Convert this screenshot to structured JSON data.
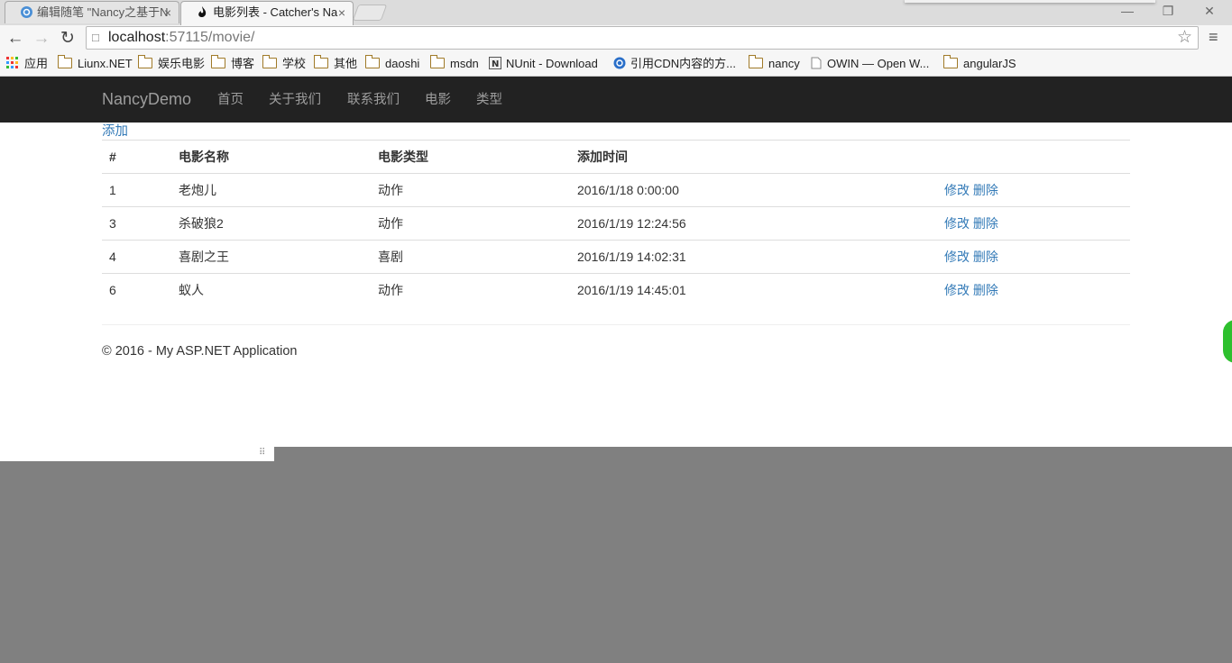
{
  "browser": {
    "tabs": [
      {
        "title": "编辑随笔 \"Nancy之基于N",
        "close": "×"
      },
      {
        "title": "电影列表 - Catcher's Na",
        "close": "×"
      }
    ],
    "window_controls": {
      "minimize": "—",
      "restore": "❐",
      "close": "✕"
    },
    "nav": {
      "back": "←",
      "forward": "→",
      "reload": "↻",
      "menu": "≡"
    },
    "address": {
      "host": "localhost",
      "path": ":57115/movie/",
      "star": "☆"
    },
    "bookmarks": [
      {
        "label": "应用",
        "icon": "apps-icon"
      },
      {
        "label": "Liunx.NET",
        "icon": "folder-icon"
      },
      {
        "label": "娱乐电影",
        "icon": "folder-icon"
      },
      {
        "label": "博客",
        "icon": "folder-icon"
      },
      {
        "label": "学校",
        "icon": "folder-icon"
      },
      {
        "label": "其他",
        "icon": "folder-icon"
      },
      {
        "label": "daoshi",
        "icon": "folder-icon"
      },
      {
        "label": "msdn",
        "icon": "folder-icon"
      },
      {
        "label": "NUnit - Download",
        "icon": "nunit-icon"
      },
      {
        "label": "引用CDN内容的方...",
        "icon": "globe-icon"
      },
      {
        "label": "nancy",
        "icon": "folder-icon"
      },
      {
        "label": "OWIN — Open W...",
        "icon": "page-icon"
      },
      {
        "label": "angularJS",
        "icon": "folder-icon"
      }
    ]
  },
  "site": {
    "brand": "NancyDemo",
    "nav": [
      "首页",
      "关于我们",
      "联系我们",
      "电影",
      "类型"
    ],
    "add_label": "添加",
    "table": {
      "headers": [
        "#",
        "电影名称",
        "电影类型",
        "添加时间",
        ""
      ],
      "rows": [
        {
          "id": "1",
          "name": "老炮儿",
          "type": "动作",
          "time": "2016/1/18 0:00:00",
          "edit": "修改",
          "delete": "删除"
        },
        {
          "id": "3",
          "name": "杀破狼2",
          "type": "动作",
          "time": "2016/1/19 12:24:56",
          "edit": "修改",
          "delete": "删除"
        },
        {
          "id": "4",
          "name": "喜剧之王",
          "type": "喜剧",
          "time": "2016/1/19 14:02:31",
          "edit": "修改",
          "delete": "删除"
        },
        {
          "id": "6",
          "name": "蚁人",
          "type": "动作",
          "time": "2016/1/19 14:45:01",
          "edit": "修改",
          "delete": "删除"
        }
      ]
    },
    "footer": "© 2016 - My ASP.NET Application"
  },
  "colors": {
    "navbar_bg": "#222222",
    "link": "#337ab7",
    "desktop_bg": "#808080"
  }
}
